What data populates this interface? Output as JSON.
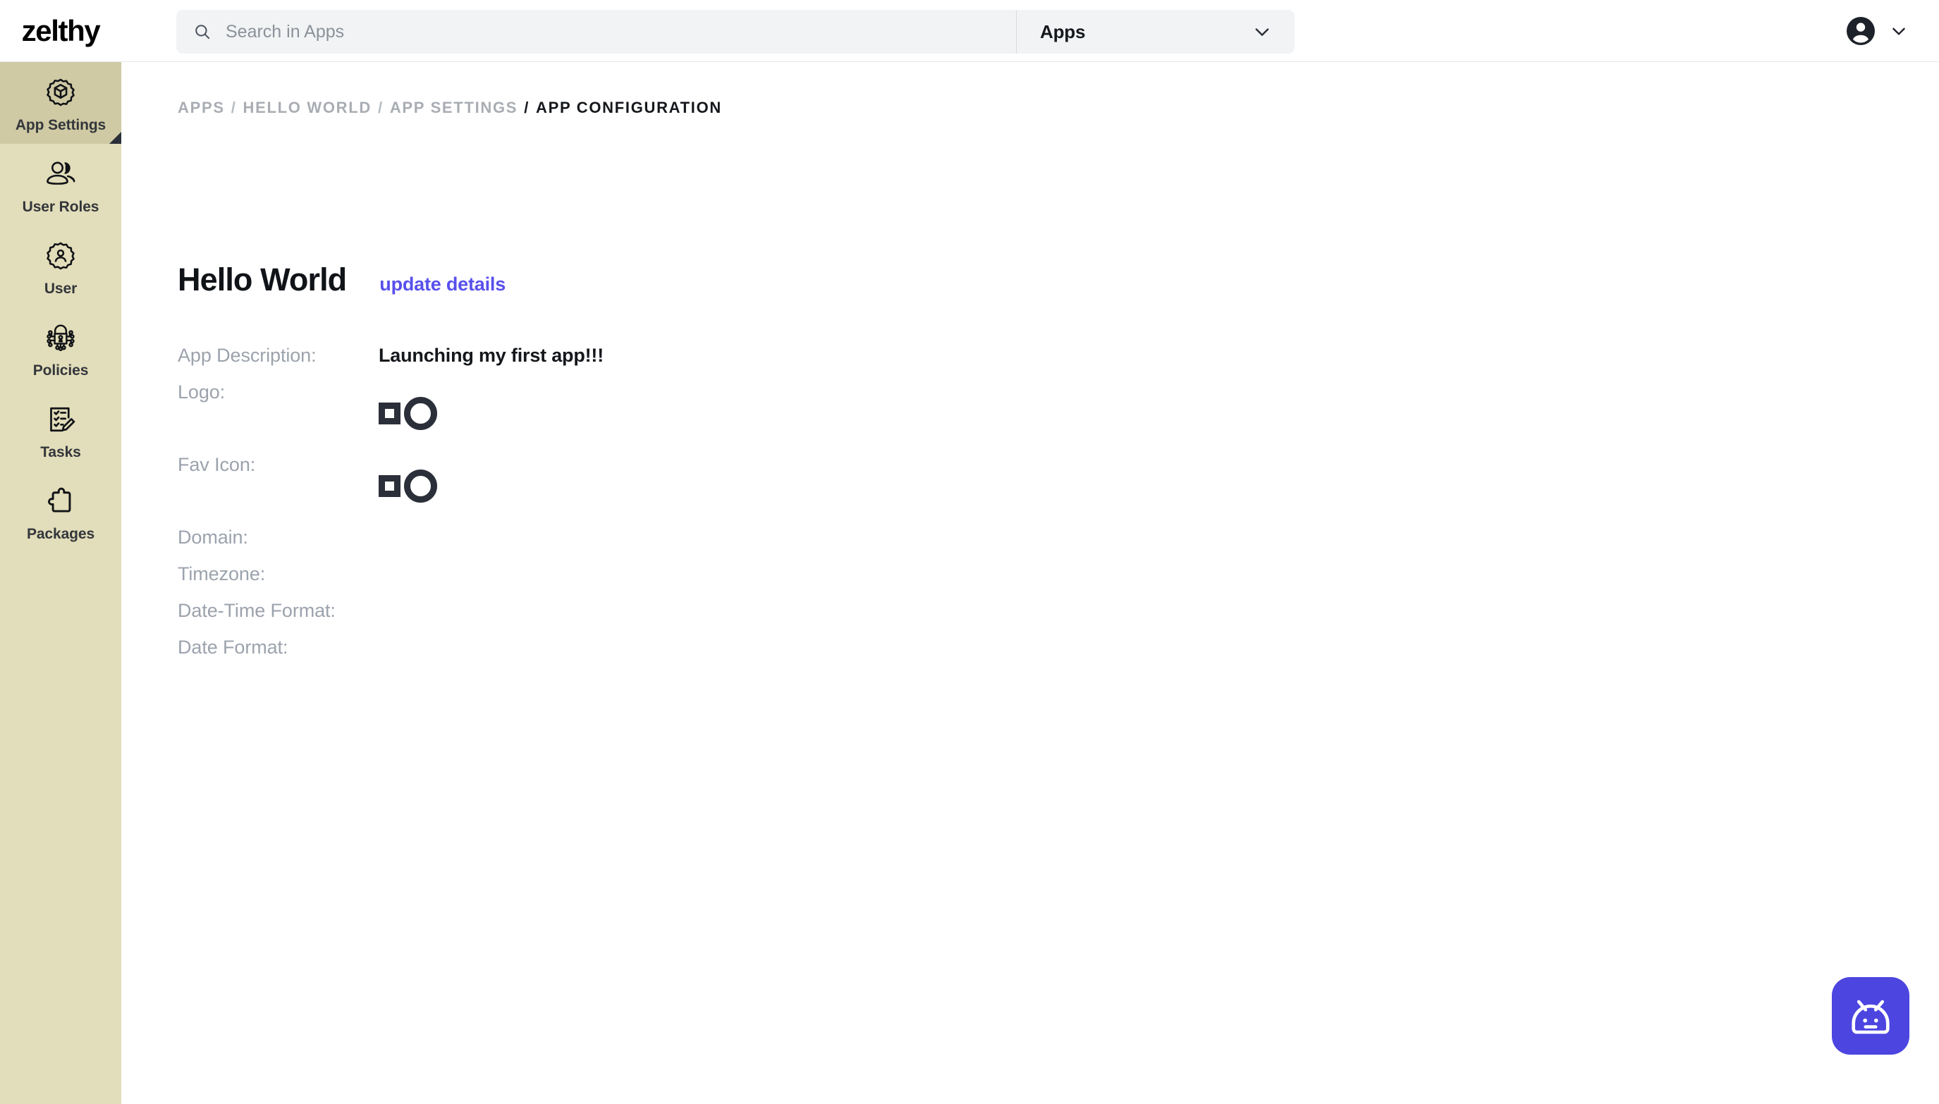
{
  "brand": {
    "name": "zelthy"
  },
  "header": {
    "search": {
      "icon": "search-icon",
      "value": "",
      "placeholder": "Search in Apps"
    },
    "scope": {
      "label": "Apps",
      "icon": "chevron-down-icon"
    },
    "profile": {
      "avatar_icon": "account-circle-icon",
      "chevron_icon": "chevron-down-icon"
    }
  },
  "sidebar": {
    "items": [
      {
        "label": "App Settings",
        "icon": "gear-cube-icon",
        "active": true
      },
      {
        "label": "User Roles",
        "icon": "users-icon",
        "active": false
      },
      {
        "label": "User",
        "icon": "gear-user-icon",
        "active": false
      },
      {
        "label": "Policies",
        "icon": "policy-lock-icon",
        "active": false
      },
      {
        "label": "Tasks",
        "icon": "tasks-checklist-icon",
        "active": false
      },
      {
        "label": "Packages",
        "icon": "puzzle-piece-icon",
        "active": false
      }
    ]
  },
  "breadcrumb": {
    "items": [
      {
        "label": "APPS",
        "current": false
      },
      {
        "label": "HELLO WORLD",
        "current": false
      },
      {
        "label": "APP SETTINGS",
        "current": false
      },
      {
        "label": "APP CONFIGURATION",
        "current": true
      }
    ],
    "separator": "/"
  },
  "page": {
    "title": "Hello World",
    "update_link": "update details",
    "fields": [
      {
        "label": "App Description:",
        "value": "Launching my first app!!!",
        "type": "text"
      },
      {
        "label": "Logo:",
        "value": "",
        "type": "media"
      },
      {
        "label": "Fav Icon:",
        "value": "",
        "type": "media"
      },
      {
        "label": "Domain:",
        "value": "",
        "type": "text"
      },
      {
        "label": "Timezone:",
        "value": "",
        "type": "text"
      },
      {
        "label": "Date-Time Format:",
        "value": "",
        "type": "text"
      },
      {
        "label": "Date Format:",
        "value": "",
        "type": "text"
      }
    ]
  },
  "chat_widget": {
    "icon": "robot-bot-icon",
    "color": "#4C45E0"
  },
  "colors": {
    "sidebar_bg": "#E2DDBA",
    "sidebar_active_bg": "#CFC9A4",
    "accent_link": "#5850EC",
    "search_bg": "#F1F3F5",
    "muted_text": "#9CA3AD",
    "chat_purple": "#4C45E0"
  }
}
